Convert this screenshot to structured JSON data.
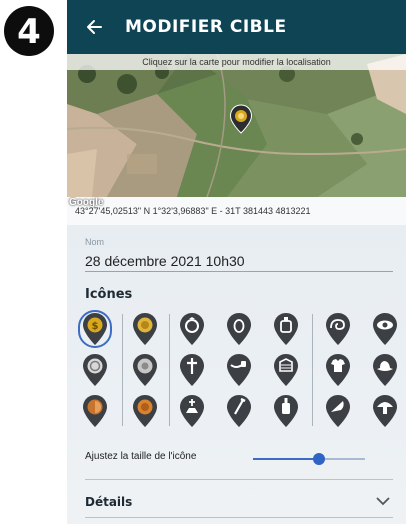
{
  "step_badge": {
    "number": "4"
  },
  "header": {
    "title": "MODIFIER CIBLE"
  },
  "map": {
    "hint": "Cliquez sur la carte pour modifier la localisation",
    "attribution": "Google",
    "marker_icon": "pin-icon"
  },
  "coordinates": {
    "text": "43°27'45,02513\" N 1°32'3,96883\" E - 31T 381443 4813221"
  },
  "name_field": {
    "label": "Nom",
    "value": "28 décembre 2021 10h30"
  },
  "icons_section": {
    "title": "Icônes",
    "rows": [
      [
        "coin-1",
        "coin-2",
        "ring",
        "pendant",
        "bottle",
        "snail",
        "eye"
      ],
      [
        "coin-3",
        "coin-4",
        "cross",
        "pipe",
        "bag",
        "shirt",
        "hat"
      ],
      [
        "coin-5",
        "coin-6",
        "grave",
        "nail",
        "bottle-2",
        "shell",
        "mushroom"
      ]
    ],
    "selected": "coin-1"
  },
  "slider": {
    "label": "Ajustez la taille de l'icône",
    "value": 0.6
  },
  "details": {
    "label": "Détails"
  },
  "colors": {
    "topbar": "#0f4455",
    "pin_dark": "#3c3f44",
    "accent_gold": "#d9a81f",
    "accent_blue": "#2f63c4"
  }
}
